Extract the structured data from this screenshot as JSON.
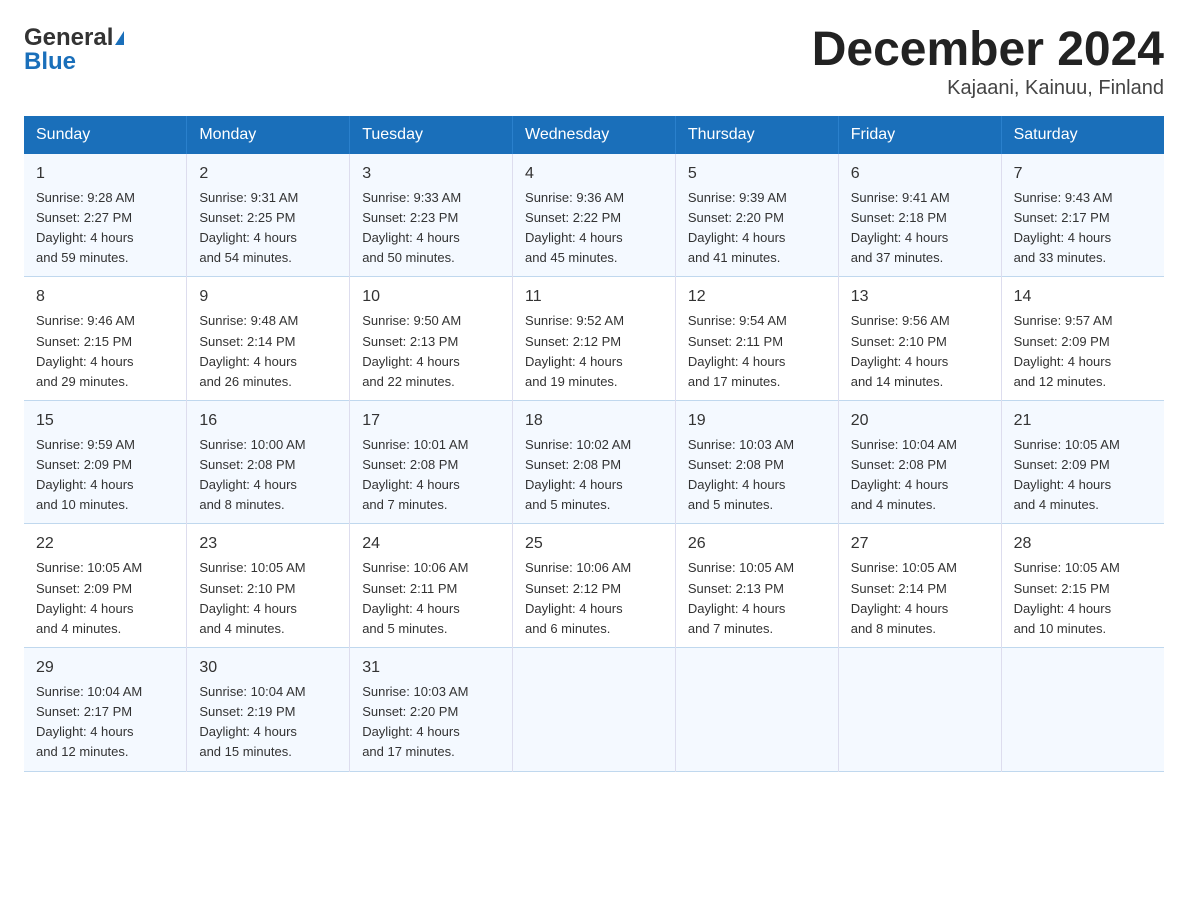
{
  "logo": {
    "line1": "General",
    "line2": "Blue"
  },
  "title": "December 2024",
  "subtitle": "Kajaani, Kainuu, Finland",
  "days": [
    "Sunday",
    "Monday",
    "Tuesday",
    "Wednesday",
    "Thursday",
    "Friday",
    "Saturday"
  ],
  "weeks": [
    [
      {
        "num": "1",
        "sunrise": "9:28 AM",
        "sunset": "2:27 PM",
        "daylight": "4 hours and 59 minutes."
      },
      {
        "num": "2",
        "sunrise": "9:31 AM",
        "sunset": "2:25 PM",
        "daylight": "4 hours and 54 minutes."
      },
      {
        "num": "3",
        "sunrise": "9:33 AM",
        "sunset": "2:23 PM",
        "daylight": "4 hours and 50 minutes."
      },
      {
        "num": "4",
        "sunrise": "9:36 AM",
        "sunset": "2:22 PM",
        "daylight": "4 hours and 45 minutes."
      },
      {
        "num": "5",
        "sunrise": "9:39 AM",
        "sunset": "2:20 PM",
        "daylight": "4 hours and 41 minutes."
      },
      {
        "num": "6",
        "sunrise": "9:41 AM",
        "sunset": "2:18 PM",
        "daylight": "4 hours and 37 minutes."
      },
      {
        "num": "7",
        "sunrise": "9:43 AM",
        "sunset": "2:17 PM",
        "daylight": "4 hours and 33 minutes."
      }
    ],
    [
      {
        "num": "8",
        "sunrise": "9:46 AM",
        "sunset": "2:15 PM",
        "daylight": "4 hours and 29 minutes."
      },
      {
        "num": "9",
        "sunrise": "9:48 AM",
        "sunset": "2:14 PM",
        "daylight": "4 hours and 26 minutes."
      },
      {
        "num": "10",
        "sunrise": "9:50 AM",
        "sunset": "2:13 PM",
        "daylight": "4 hours and 22 minutes."
      },
      {
        "num": "11",
        "sunrise": "9:52 AM",
        "sunset": "2:12 PM",
        "daylight": "4 hours and 19 minutes."
      },
      {
        "num": "12",
        "sunrise": "9:54 AM",
        "sunset": "2:11 PM",
        "daylight": "4 hours and 17 minutes."
      },
      {
        "num": "13",
        "sunrise": "9:56 AM",
        "sunset": "2:10 PM",
        "daylight": "4 hours and 14 minutes."
      },
      {
        "num": "14",
        "sunrise": "9:57 AM",
        "sunset": "2:09 PM",
        "daylight": "4 hours and 12 minutes."
      }
    ],
    [
      {
        "num": "15",
        "sunrise": "9:59 AM",
        "sunset": "2:09 PM",
        "daylight": "4 hours and 10 minutes."
      },
      {
        "num": "16",
        "sunrise": "10:00 AM",
        "sunset": "2:08 PM",
        "daylight": "4 hours and 8 minutes."
      },
      {
        "num": "17",
        "sunrise": "10:01 AM",
        "sunset": "2:08 PM",
        "daylight": "4 hours and 7 minutes."
      },
      {
        "num": "18",
        "sunrise": "10:02 AM",
        "sunset": "2:08 PM",
        "daylight": "4 hours and 5 minutes."
      },
      {
        "num": "19",
        "sunrise": "10:03 AM",
        "sunset": "2:08 PM",
        "daylight": "4 hours and 5 minutes."
      },
      {
        "num": "20",
        "sunrise": "10:04 AM",
        "sunset": "2:08 PM",
        "daylight": "4 hours and 4 minutes."
      },
      {
        "num": "21",
        "sunrise": "10:05 AM",
        "sunset": "2:09 PM",
        "daylight": "4 hours and 4 minutes."
      }
    ],
    [
      {
        "num": "22",
        "sunrise": "10:05 AM",
        "sunset": "2:09 PM",
        "daylight": "4 hours and 4 minutes."
      },
      {
        "num": "23",
        "sunrise": "10:05 AM",
        "sunset": "2:10 PM",
        "daylight": "4 hours and 4 minutes."
      },
      {
        "num": "24",
        "sunrise": "10:06 AM",
        "sunset": "2:11 PM",
        "daylight": "4 hours and 5 minutes."
      },
      {
        "num": "25",
        "sunrise": "10:06 AM",
        "sunset": "2:12 PM",
        "daylight": "4 hours and 6 minutes."
      },
      {
        "num": "26",
        "sunrise": "10:05 AM",
        "sunset": "2:13 PM",
        "daylight": "4 hours and 7 minutes."
      },
      {
        "num": "27",
        "sunrise": "10:05 AM",
        "sunset": "2:14 PM",
        "daylight": "4 hours and 8 minutes."
      },
      {
        "num": "28",
        "sunrise": "10:05 AM",
        "sunset": "2:15 PM",
        "daylight": "4 hours and 10 minutes."
      }
    ],
    [
      {
        "num": "29",
        "sunrise": "10:04 AM",
        "sunset": "2:17 PM",
        "daylight": "4 hours and 12 minutes."
      },
      {
        "num": "30",
        "sunrise": "10:04 AM",
        "sunset": "2:19 PM",
        "daylight": "4 hours and 15 minutes."
      },
      {
        "num": "31",
        "sunrise": "10:03 AM",
        "sunset": "2:20 PM",
        "daylight": "4 hours and 17 minutes."
      },
      null,
      null,
      null,
      null
    ]
  ],
  "labels": {
    "sunrise": "Sunrise:",
    "sunset": "Sunset:",
    "daylight": "Daylight:"
  }
}
